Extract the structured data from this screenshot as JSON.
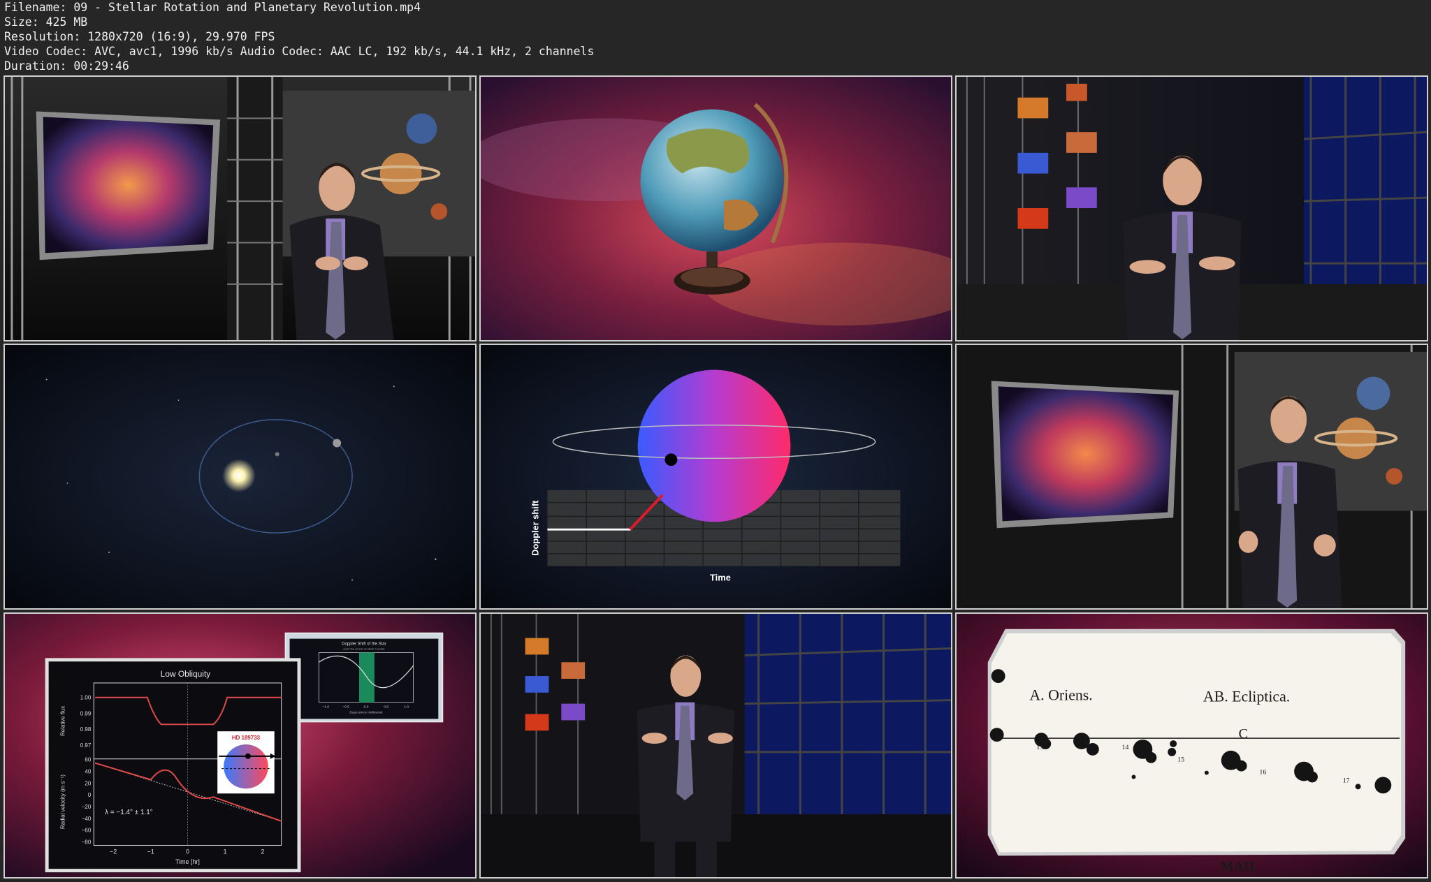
{
  "header": {
    "filename": "Filename: 09 - Stellar Rotation and Planetary Revolution.mp4",
    "size": "Size: 425 MB",
    "resolution": "Resolution: 1280x720 (16:9), 29.970 FPS",
    "codec": "Video Codec: AVC, avc1, 1996 kb/s Audio Codec: AAC LC, 192 kb/s, 44.1 kHz, 2 channels",
    "duration": "Duration: 00:29:46"
  },
  "frames": {
    "doppler": {
      "ylabel": "Doppler shift",
      "xlabel": "Time"
    },
    "obliquity": {
      "title": "Low Obliquity",
      "ylabel_top": "Relative flux",
      "ylabel_bottom": "Radial velocity (m s⁻¹)",
      "xlabel": "Time [hr]",
      "star_label": "HD 189733",
      "lambda": "λ = −1.4° ± 1.1°",
      "flux_ticks": [
        "1.00",
        "0.99",
        "0.98",
        "0.97"
      ],
      "rv_ticks": [
        "60",
        "40",
        "20",
        "0",
        "−20",
        "−40",
        "−60",
        "−80"
      ],
      "time_ticks": [
        "−2",
        "−1",
        "0",
        "1",
        "2"
      ],
      "inset_title": "Doppler Shift of the Star",
      "inset_subtitle": "(over the course of about a week)",
      "inset_xlabel": "Days since midtransit",
      "inset_ticks": [
        "−1.0",
        "−0.5",
        "0.0",
        "0.5",
        "1.0"
      ]
    },
    "manuscript": {
      "left_label": "A. Oriens.",
      "right_label": "AB. Ecliptica.",
      "c_label": "C",
      "bottom_label": "MAII.",
      "numbers": [
        "13",
        "14",
        "15",
        "16",
        "17"
      ]
    }
  }
}
